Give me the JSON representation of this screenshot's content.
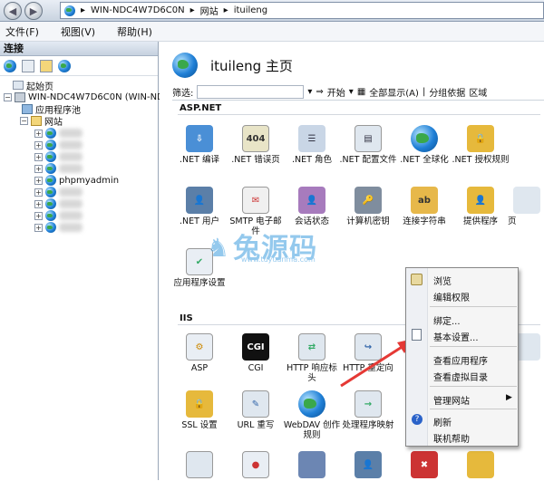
{
  "address": {
    "segments": [
      "WIN-NDC4W7D6C0N",
      "网站",
      "ituileng"
    ]
  },
  "menu": [
    "文件(F)",
    "视图(V)",
    "帮助(H)"
  ],
  "left_panel": {
    "title": "连接",
    "tree": [
      {
        "label": "起始页"
      },
      {
        "label": "WIN-NDC4W7D6C0N (WIN-NDC4W"
      },
      {
        "label": "应用程序池"
      },
      {
        "label": "网站"
      },
      {
        "label": ""
      },
      {
        "label": ""
      },
      {
        "label": ""
      },
      {
        "label": ""
      },
      {
        "label": "phpmyadmin"
      },
      {
        "label": ""
      },
      {
        "label": ""
      },
      {
        "label": ""
      },
      {
        "label": ""
      }
    ]
  },
  "page": {
    "title": "ituileng 主页",
    "filter_label": "筛选:",
    "go_label": "开始",
    "show_all": "全部显示(A)",
    "group_by": "分组依据",
    "group_value": "区域"
  },
  "sections": [
    {
      "name": "ASP.NET",
      "items": [
        ".NET 编译",
        ".NET 错误页",
        ".NET 角色",
        ".NET 配置文件",
        ".NET 全球化",
        ".NET 授权规则",
        ".NET 用户",
        "SMTP 电子邮件",
        "会话状态",
        "计算机密钥",
        "连接字符串",
        "提供程序",
        "页",
        "应用程序设置"
      ]
    },
    {
      "name": "IIS",
      "items": [
        "ASP",
        "CGI",
        "HTTP 响应标头",
        "HTTP 重定向",
        "",
        "",
        "",
        "SSL 设置",
        "URL 重写",
        "WebDAV 创作规则",
        "处理程序映射"
      ]
    }
  ],
  "watermark": {
    "title": "兔源码",
    "url": "www.tuyuanma.com"
  },
  "context_menu": {
    "items": [
      "浏览",
      "编辑权限",
      "绑定...",
      "基本设置...",
      "查看应用程序",
      "查看虚拟目录",
      "管理网站",
      "刷新",
      "联机帮助"
    ]
  },
  "colors": {
    "arrow": "#e53935",
    "accent": "#1f7fd6"
  }
}
